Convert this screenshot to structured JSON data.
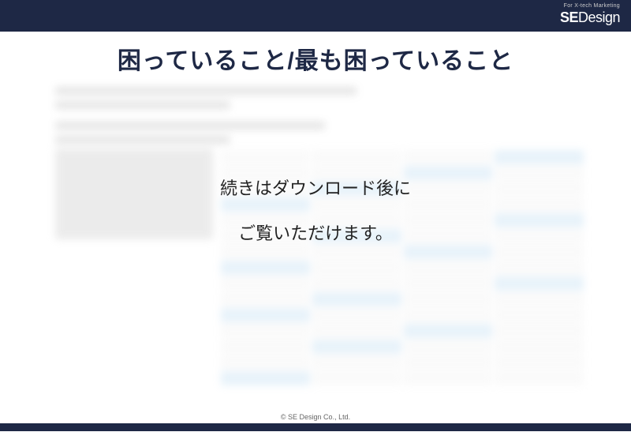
{
  "header": {
    "tagline": "For X-tech Marketing",
    "brand_se": "SE",
    "brand_design": "Design"
  },
  "title": "困っていること/最も困っていること",
  "overlay": {
    "line1": "続きはダウンロード後に",
    "line2": "ご覧いただけます。"
  },
  "footer": {
    "copyright": "© SE Design Co., Ltd."
  }
}
